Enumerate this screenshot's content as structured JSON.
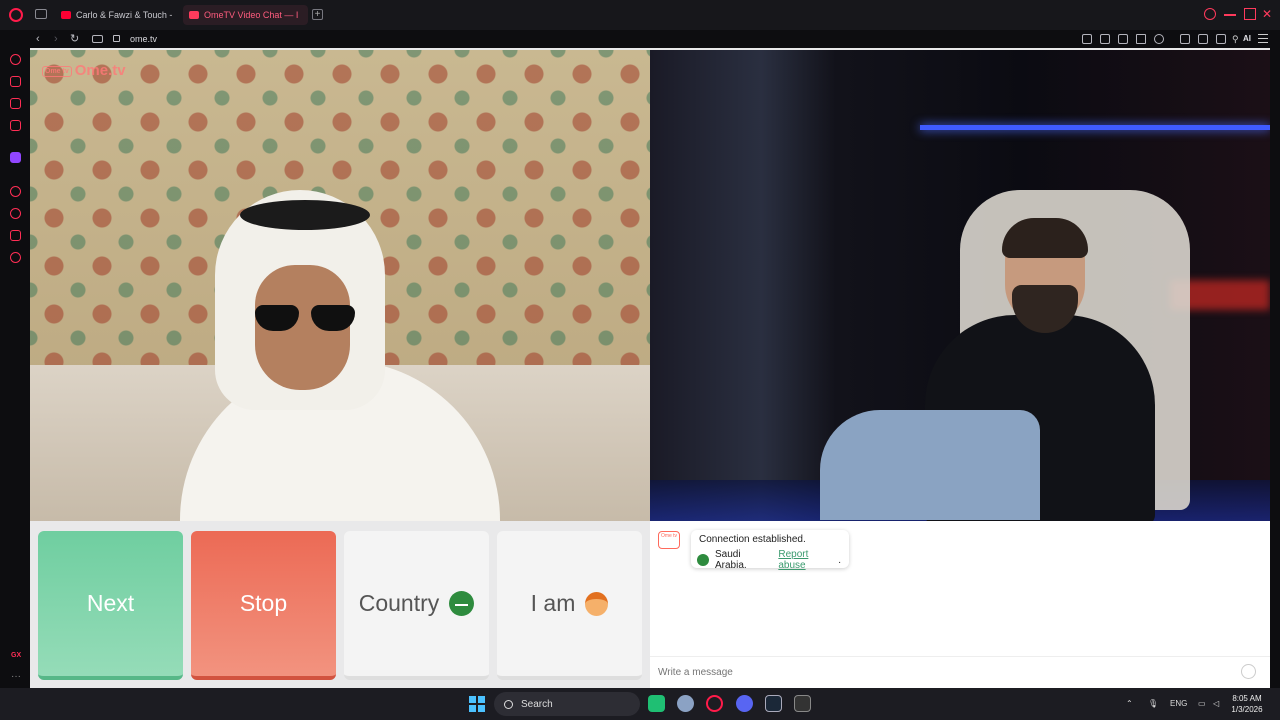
{
  "browser": {
    "tabs": [
      {
        "label": "Carlo & Fawzi & Touch - Yo",
        "active": false,
        "favicon_color": "#ff0033"
      },
      {
        "label": "OmeTV Video Chat — I",
        "active": true,
        "favicon_color": "#ff3b5c"
      }
    ],
    "url": "ome.tv",
    "ai_label": "AI"
  },
  "sidebar": {
    "gx_label": "GX",
    "icons": [
      "opera-icon",
      "aria-icon",
      "messenger-icon",
      "player-icon",
      "twitch-icon",
      "video-icon",
      "history-icon",
      "extensions-icon",
      "settings-icon"
    ]
  },
  "video": {
    "logo_badge": "Ome tv",
    "logo_text": "Ome.tv"
  },
  "controls": {
    "next_label": "Next",
    "stop_label": "Stop",
    "country_label": "Country",
    "iam_label": "I am"
  },
  "chat": {
    "logo": "Ome tv",
    "line1": "Connection established.",
    "country": "Saudi Arabia.",
    "report_label": "Report abuse",
    "report_suffix": ".",
    "input_placeholder": "Write a message"
  },
  "taskbar": {
    "search_label": "Search",
    "language": "ENG",
    "time": "8:05 AM",
    "date": "1/3/2026"
  },
  "colors": {
    "accent": "#ff1b4a",
    "next_green": "#6fcea0",
    "stop_red": "#ec6a55"
  }
}
